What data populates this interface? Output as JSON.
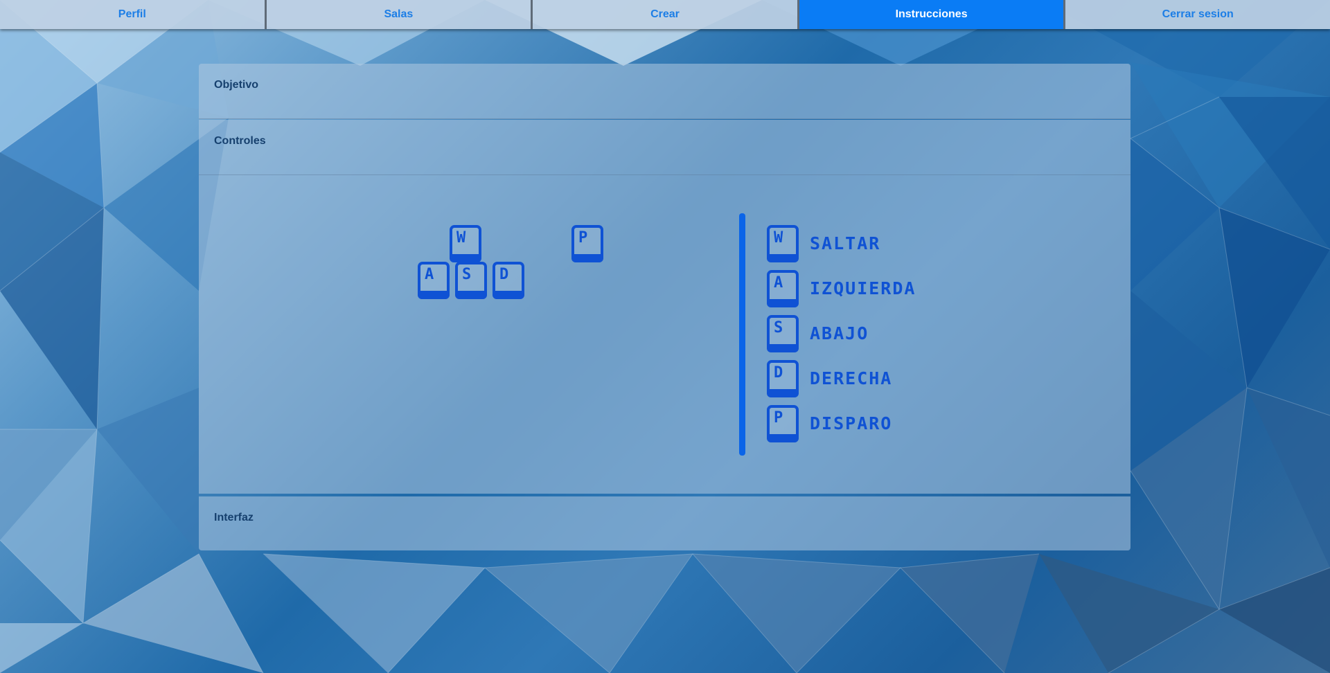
{
  "nav": {
    "tabs": [
      {
        "label": "Perfil",
        "active": false
      },
      {
        "label": "Salas",
        "active": false
      },
      {
        "label": "Crear",
        "active": false
      },
      {
        "label": "Instrucciones",
        "active": true
      },
      {
        "label": "Cerrar sesion",
        "active": false
      }
    ]
  },
  "sections": {
    "objetivo": "Objetivo",
    "controles": "Controles",
    "interfaz": "Interfaz"
  },
  "keys": {
    "w": "W",
    "a": "A",
    "s": "S",
    "d": "D",
    "p": "P"
  },
  "legend": [
    {
      "key": "W",
      "action": "SALTAR"
    },
    {
      "key": "A",
      "action": "IZQUIERDA"
    },
    {
      "key": "S",
      "action": "ABAJO"
    },
    {
      "key": "D",
      "action": "DERECHA"
    },
    {
      "key": "P",
      "action": "DISPARO"
    }
  ],
  "colors": {
    "accent": "#0a7cf5",
    "key_blue": "#0f52d4",
    "heading": "#16406e"
  },
  "icons": [
    "keyboard-key-icon"
  ]
}
